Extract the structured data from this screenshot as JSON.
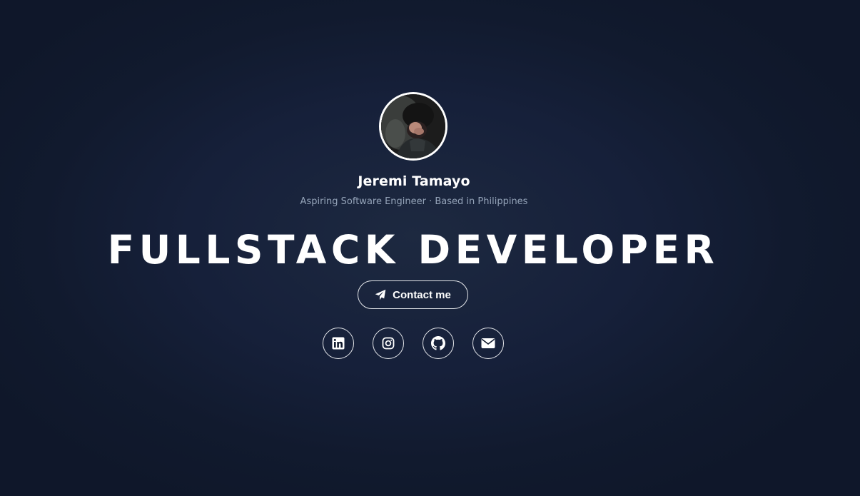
{
  "profile": {
    "name": "Jeremi Tamayo",
    "tagline": "Aspiring Software Engineer · Based in Philippines",
    "avatar": "profile-photo"
  },
  "hero": {
    "headline": "FULLSTACK DEVELOPER"
  },
  "contact": {
    "label": "Contact me",
    "icon": "paper-plane-icon"
  },
  "socials": [
    {
      "name": "LinkedIn",
      "icon": "linkedin-icon"
    },
    {
      "name": "Instagram",
      "icon": "instagram-icon"
    },
    {
      "name": "GitHub",
      "icon": "github-icon"
    },
    {
      "name": "Email",
      "icon": "envelope-icon"
    }
  ],
  "colors": {
    "background": "#0f172a",
    "background_center": "#1d2940",
    "text": "#ffffff",
    "muted_text": "#94a3b8",
    "border": "#e5e7eb"
  }
}
